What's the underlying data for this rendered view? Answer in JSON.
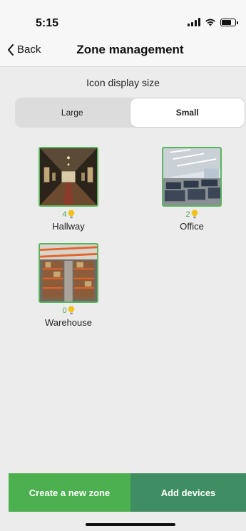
{
  "status_bar": {
    "time": "5:15",
    "battery_level": 0.7
  },
  "nav": {
    "back_label": "Back",
    "title": "Zone management"
  },
  "display_size": {
    "label": "Icon display size",
    "options": [
      "Large",
      "Small"
    ],
    "selected": "Small"
  },
  "zones": [
    {
      "name": "Hallway",
      "count": "4",
      "image": "hallway"
    },
    {
      "name": "Office",
      "count": "2",
      "image": "office"
    },
    {
      "name": "Warehouse",
      "count": "0",
      "image": "warehouse"
    }
  ],
  "actions": {
    "create_label": "Create a new zone",
    "add_label": "Add devices"
  },
  "colors": {
    "accent_green": "#4caf50",
    "dark_green": "#3f8e63",
    "count_green": "#4aa84e",
    "bulb_yellow": "#f2c21b"
  }
}
